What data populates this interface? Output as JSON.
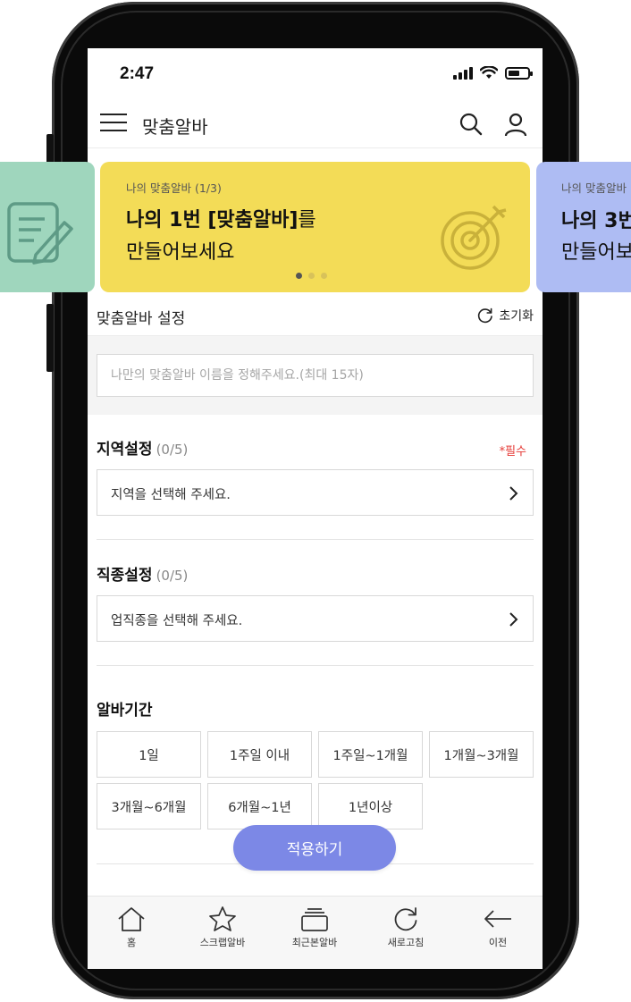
{
  "status_bar": {
    "time": "2:47"
  },
  "header": {
    "title": "맞춤알바"
  },
  "banners": {
    "left": {
      "icon": "document-edit-icon"
    },
    "main": {
      "subtitle": "나의 맞춤알바 (1/3)",
      "title_bold": "나의 1번 [맞춤알바]",
      "title_suffix": "를",
      "title_line2": "만들어보세요",
      "icon": "target-icon",
      "page_dots": {
        "count": 3,
        "active": 1
      }
    },
    "right": {
      "subtitle": "나의 맞춤알바",
      "title_bold": "나의 3번",
      "title_line2": "만들어보"
    }
  },
  "settings": {
    "title": "맞춤알바 설정",
    "reset_label": "초기화",
    "name_placeholder": "나만의 맞춤알바 이름을 정해주세요.(최대 15자)"
  },
  "region": {
    "title": "지역설정",
    "count": "(0/5)",
    "required": "*필수",
    "placeholder": "지역을 선택해 주세요."
  },
  "job": {
    "title": "직종설정",
    "count": "(0/5)",
    "placeholder": "업직종을 선택해 주세요."
  },
  "period": {
    "title": "알바기간",
    "options": [
      "1일",
      "1주일 이내",
      "1주일~1개월",
      "1개월~3개월",
      "3개월~6개월",
      "6개월~1년",
      "1년이상"
    ]
  },
  "apply_label": "적용하기",
  "bottom_nav": [
    {
      "label": "홈",
      "icon": "home-icon"
    },
    {
      "label": "스크랩알바",
      "icon": "star-icon"
    },
    {
      "label": "최근본알바",
      "icon": "stack-icon"
    },
    {
      "label": "새로고침",
      "icon": "refresh-icon"
    },
    {
      "label": "이전",
      "icon": "back-arrow-icon"
    }
  ],
  "colors": {
    "banner_yellow": "#f3dc57",
    "banner_green": "#9fd6bd",
    "banner_blue": "#aebcf3",
    "apply_button": "#7c88e6",
    "required": "#e53935"
  }
}
